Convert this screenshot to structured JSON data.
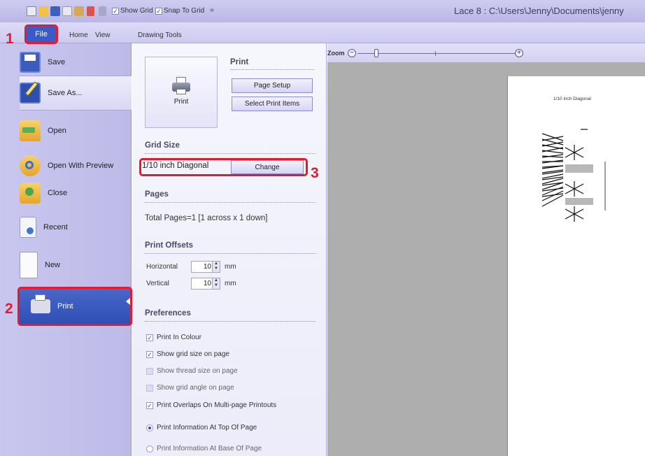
{
  "window": {
    "title": "Lace 8 : C:\\Users\\Jenny\\Documents\\jenny"
  },
  "quick_access": {
    "show_grid_label": "Show Grid",
    "snap_to_grid_label": "Snap To Grid",
    "more_glyph": "="
  },
  "ribbon": {
    "tabs": [
      "File",
      "Home",
      "View",
      "Drawing Tools"
    ]
  },
  "nav": {
    "items": [
      {
        "label": "Save",
        "icon": "save-icon"
      },
      {
        "label": "Save As...",
        "icon": "save-as-icon"
      },
      {
        "label": "Open",
        "icon": "folder-open-icon"
      },
      {
        "label": "Open With Preview",
        "icon": "preview-icon"
      },
      {
        "label": "Close",
        "icon": "close-folder-icon"
      },
      {
        "label": "Recent",
        "icon": "recent-icon"
      },
      {
        "label": "New",
        "icon": "new-document-icon"
      },
      {
        "label": "Print",
        "icon": "printer-icon"
      }
    ]
  },
  "print_panel": {
    "big_button_label": "Print",
    "section_print": "Print",
    "page_setup_label": "Page Setup",
    "select_items_label": "Select Print Items",
    "section_grid": "Grid Size",
    "grid_size_value": "1/10 inch Diagonal",
    "change_label": "Change",
    "section_pages": "Pages",
    "pages_text": "Total Pages=1  [1 across x 1 down]",
    "section_offsets": "Print Offsets",
    "horizontal_label": "Horizontal",
    "horizontal_value": "10",
    "vertical_label": "Vertical",
    "vertical_value": "10",
    "unit": "mm",
    "section_prefs": "Preferences",
    "preferences": [
      {
        "label": "Print In Colour",
        "checked": true
      },
      {
        "label": "Show grid size on page",
        "checked": true
      },
      {
        "label": "Show thread size on page",
        "checked": false
      },
      {
        "label": "Show grid angle on page",
        "checked": false
      },
      {
        "label": "Print Overlaps On Multi-page Printouts",
        "checked": true
      }
    ],
    "radio_options": [
      {
        "label": "Print Information At Top Of Page",
        "selected": true
      },
      {
        "label": "Print Information At Base Of Page",
        "selected": false
      }
    ]
  },
  "preview": {
    "zoom_label": "Zoom",
    "zoom_out_glyph": "−",
    "zoom_in_glyph": "+",
    "zoom_level": 0.12,
    "page_caption": "1/10 inch Diagonal"
  },
  "annotations": {
    "step1": "1",
    "step2": "2",
    "step3": "3"
  },
  "colors": {
    "annotation_red": "#e41b2f",
    "selected_blue": "#3a5bc7"
  }
}
